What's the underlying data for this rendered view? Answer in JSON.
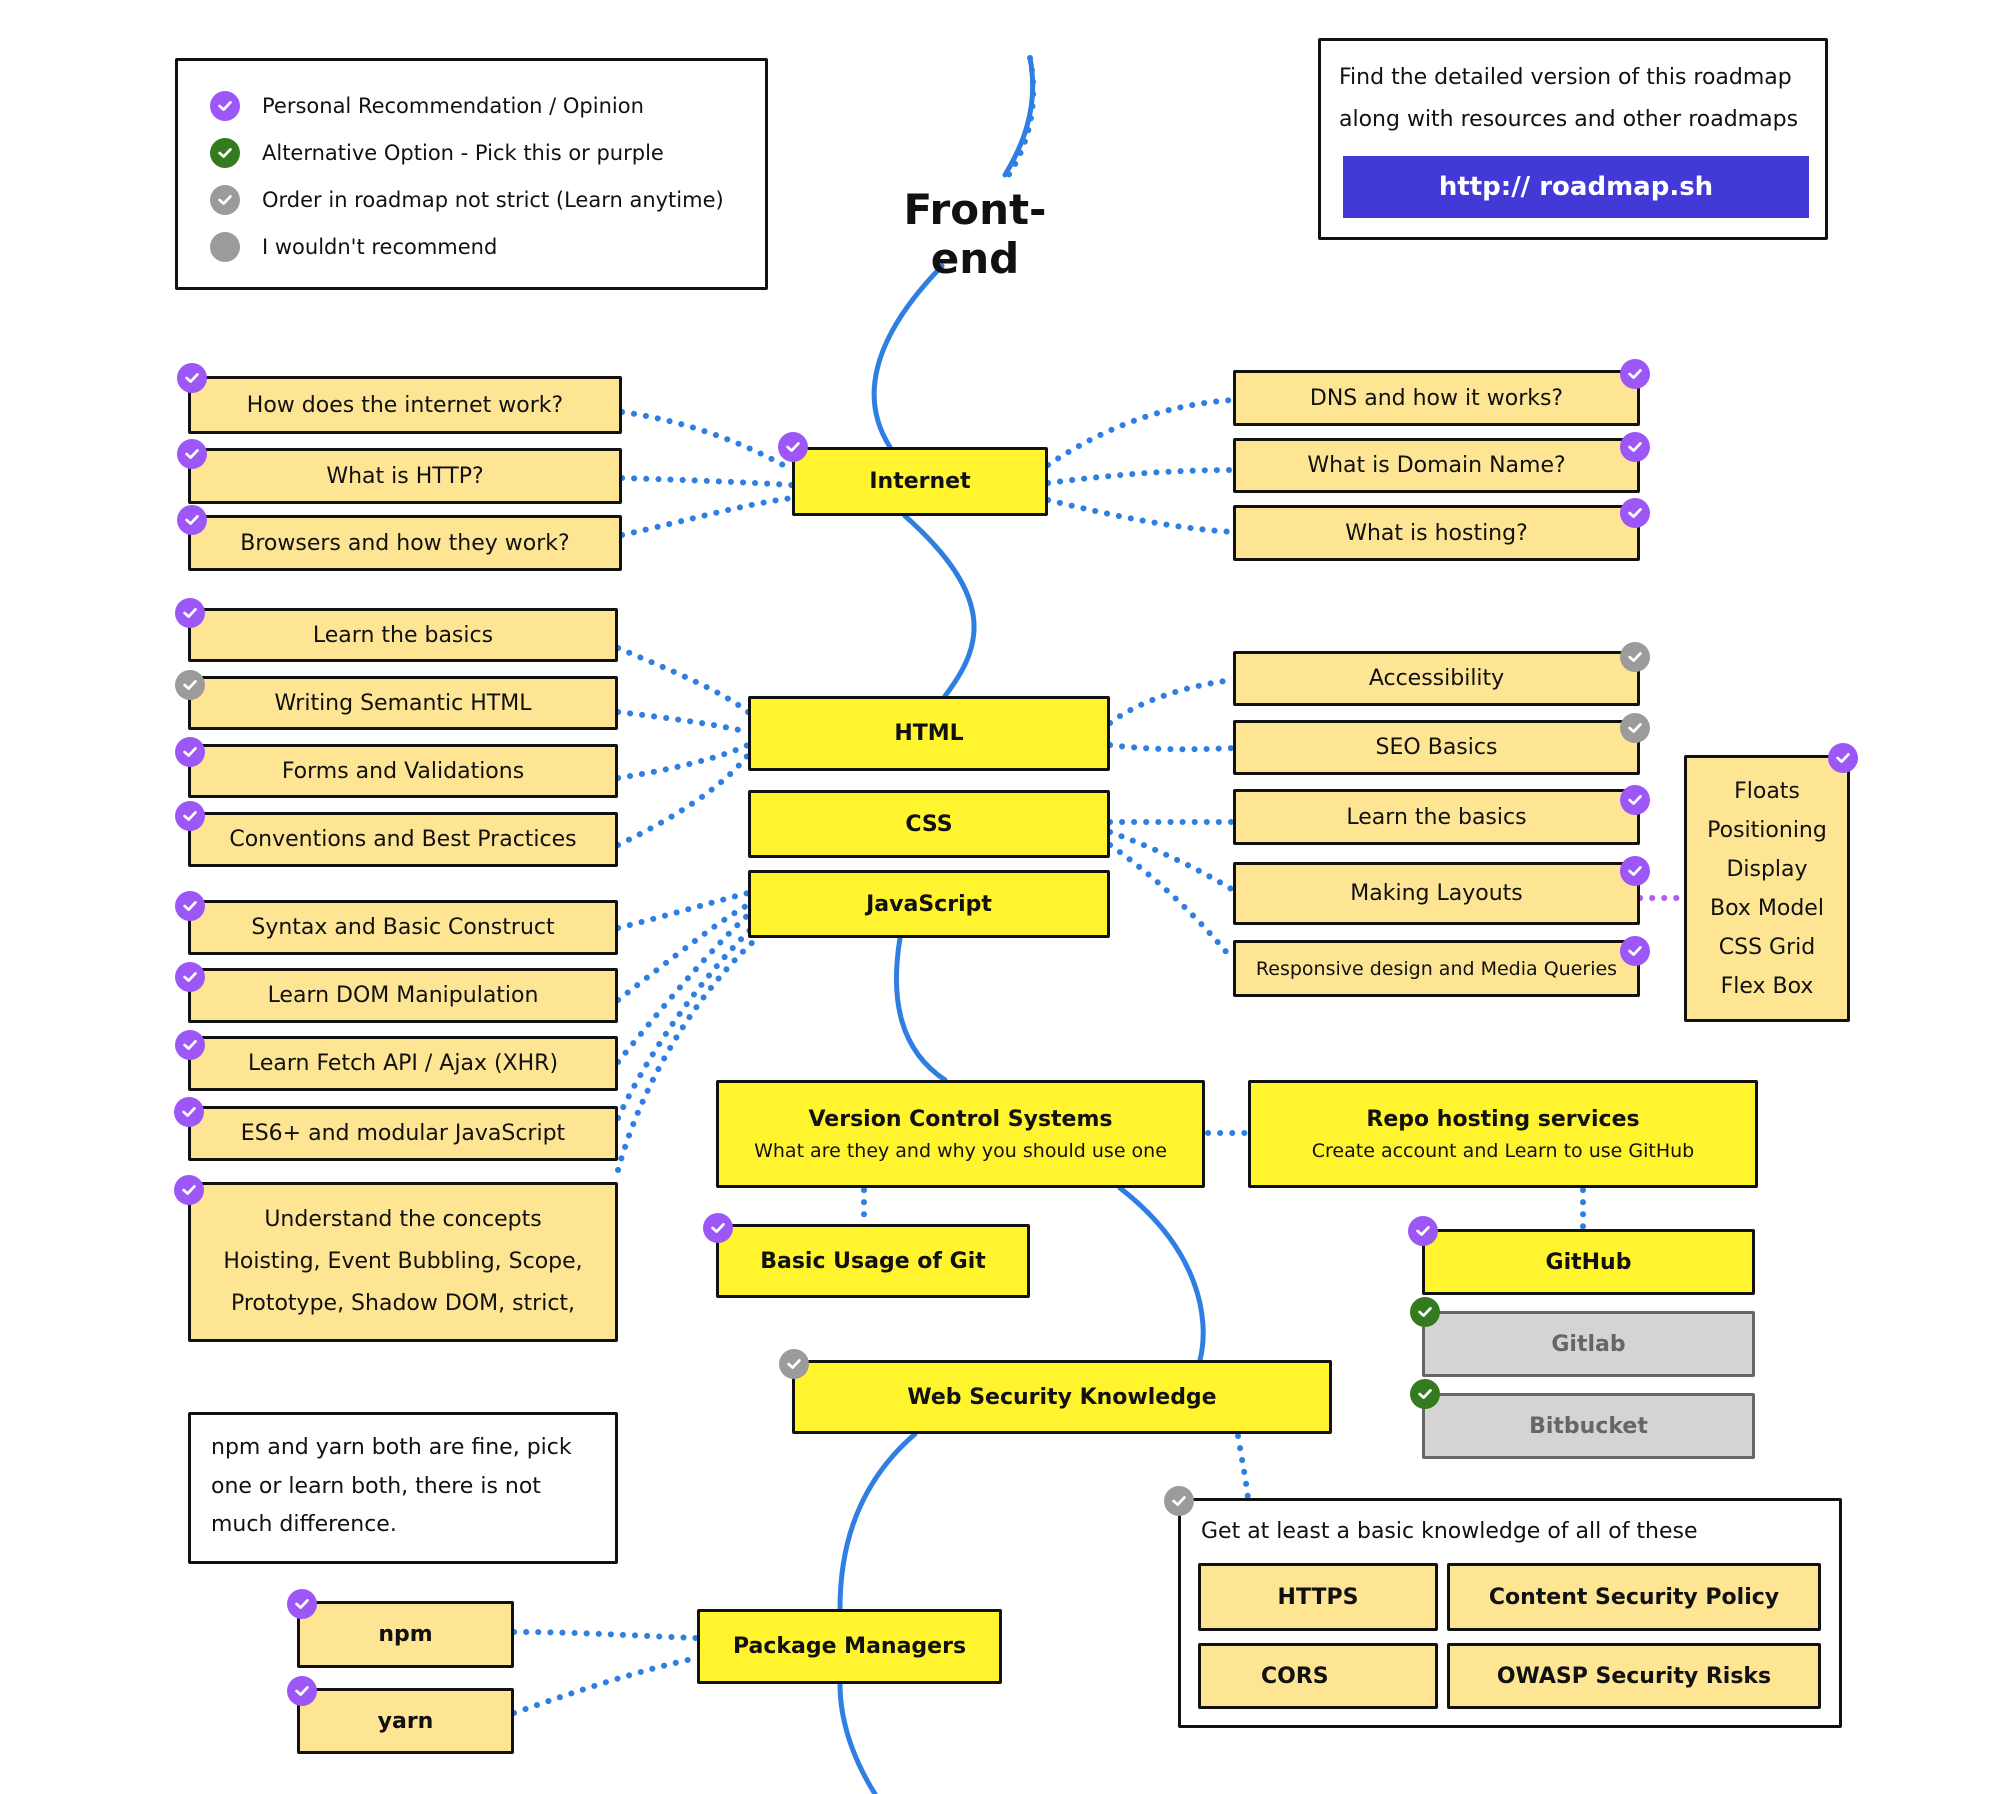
{
  "legend": {
    "items": [
      {
        "label": "Personal Recommendation / Opinion",
        "icon": "check-circle-icon",
        "color": "#9d57f7"
      },
      {
        "label": "Alternative Option - Pick this or purple",
        "icon": "check-circle-icon",
        "color": "#347a1f"
      },
      {
        "label": "Order in roadmap not strict (Learn anytime)",
        "icon": "check-circle-icon",
        "color": "#9b9b9b"
      },
      {
        "label": "I wouldn't recommend",
        "icon": "circle-icon",
        "color": "#9b9b9b"
      }
    ]
  },
  "info": {
    "line1": "Find the detailed version of this roadmap",
    "line2": "along with resources and other roadmaps",
    "link_label": "http:// roadmap.sh"
  },
  "title": "Front-end",
  "internet": {
    "label": "Internet",
    "left": [
      "How does the internet work?",
      "What is HTTP?",
      "Browsers and how they work?"
    ],
    "right": [
      "DNS and how it works?",
      "What is Domain Name?",
      "What is hosting?"
    ]
  },
  "html": {
    "label": "HTML",
    "left": [
      "Learn the basics",
      "Writing Semantic HTML",
      "Forms and Validations",
      "Conventions and Best Practices"
    ],
    "right": [
      "Accessibility",
      "SEO Basics"
    ]
  },
  "css": {
    "label": "CSS",
    "right": [
      "Learn the basics",
      "Making Layouts",
      "Responsive design and Media Queries"
    ],
    "layouts": [
      "Floats",
      "Positioning",
      "Display",
      "Box Model",
      "CSS Grid",
      "Flex Box"
    ]
  },
  "javascript": {
    "label": "JavaScript",
    "left": [
      "Syntax and Basic Construct",
      "Learn DOM Manipulation",
      "Learn Fetch API / Ajax (XHR)",
      "ES6+ and modular JavaScript"
    ],
    "concepts": [
      "Understand the concepts",
      "Hoisting, Event Bubbling, Scope,",
      "Prototype, Shadow DOM, strict,"
    ]
  },
  "vcs": {
    "title": "Version Control Systems",
    "subtitle": "What are they and why you should use one",
    "basic_git": "Basic Usage of Git"
  },
  "repo": {
    "title": "Repo hosting services",
    "subtitle": "Create account and Learn to use GitHub",
    "options": [
      "GitHub",
      "Gitlab",
      "Bitbucket"
    ]
  },
  "security": {
    "label": "Web Security Knowledge",
    "note": "Get at least a basic knowledge of all of these",
    "items": [
      "HTTPS",
      "Content Security Policy",
      "CORS",
      "OWASP Security Risks"
    ]
  },
  "packages": {
    "note": [
      "npm and yarn both are fine, pick",
      "one or learn both, there is not",
      "much difference."
    ],
    "label": "Package Managers",
    "items": [
      "npm",
      "yarn"
    ]
  },
  "colors": {
    "recommended": "#9d57f7",
    "alternative": "#347a1f",
    "anytime": "#9b9b9b",
    "main_node": "#fff42e",
    "sub_node": "#fde594",
    "path": "#2f7fe3",
    "cta": "#4239d6"
  }
}
